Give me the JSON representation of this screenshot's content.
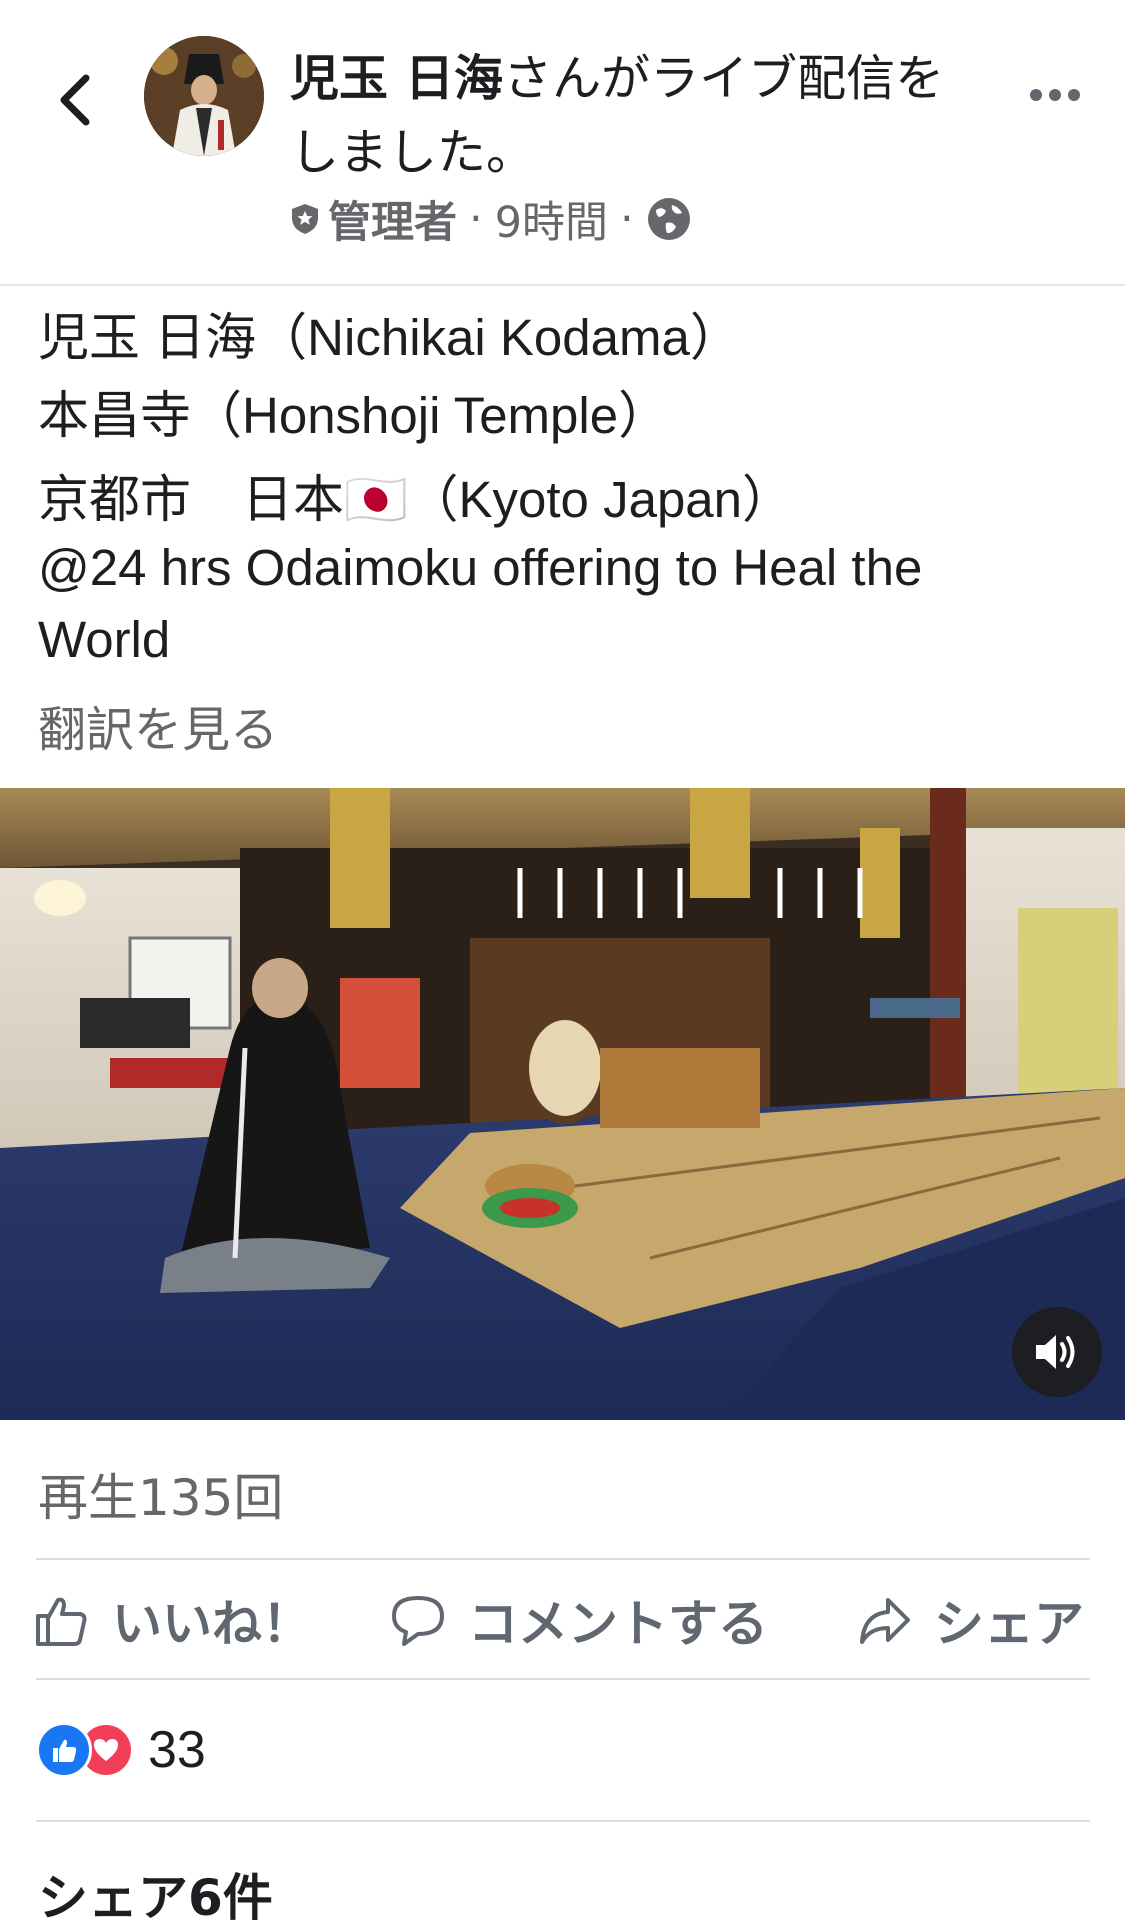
{
  "header": {
    "author_name": "児玉 日海",
    "title_suffix": "さんがライブ配信をしました。",
    "role": "管理者",
    "time": "9時間",
    "separator": "·"
  },
  "post": {
    "lines": [
      "児玉 日海（Nichikai Kodama）",
      "本昌寺（Honshoji Temple）",
      "京都市　日本🇯🇵（Kyoto Japan）",
      "@24 hrs Odaimoku offering to Heal the",
      "World"
    ],
    "see_translation": "翻訳を見る"
  },
  "stats": {
    "views": "再生135回",
    "reaction_count": "33",
    "shares": "シェア6件"
  },
  "actions": {
    "like": "いいね！",
    "comment": "コメントする",
    "share": "シェア"
  },
  "icons": {
    "back": "chevron-left-icon",
    "more": "more-dots-icon",
    "admin": "shield-icon",
    "privacy": "globe-icon",
    "volume": "speaker-icon",
    "like": "thumbs-up-icon",
    "comment": "comment-bubble-icon",
    "share": "share-arrow-icon",
    "reaction_like": "like-reaction-icon",
    "reaction_love": "love-reaction-icon"
  },
  "colors": {
    "facebook_blue": "#1877f2",
    "love_red": "#f33e58",
    "secondary_text": "#65676b"
  }
}
